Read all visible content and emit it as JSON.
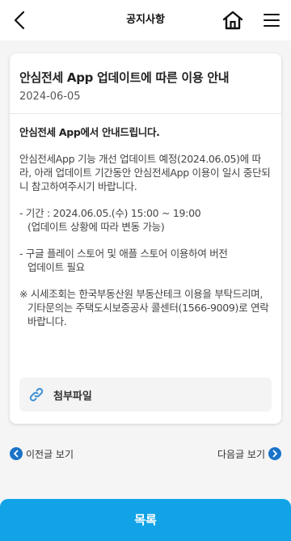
{
  "header": {
    "title": "공지사항"
  },
  "notice": {
    "title": "안심전세 App 업데이트에 따른 이용 안내",
    "date": "2024-06-05",
    "body": {
      "heading": "안심전세 App에서 안내드립니다.",
      "intro": "안심전세App 기능 개선 업데이트 예정(2024.06.05)에 따라, 아래 업데이트 기간동안 안심전세App 이용이 일시 중단되니 참고하여주시기 바랍니다.",
      "period_line1": "- 기간 : 2024.06.05.(수) 15:00 ~ 19:00",
      "period_line2": "(업데이트 상황에 따라 변동 가능)",
      "store_line1": "- 구글 플레이 스토어 및 애플 스토어 이용하여 버전",
      "store_line2": "업데이트 필요",
      "contact": "※ 시세조회는 한국부동산원 부동산테크 이용을 부탁드리며, 기타문의는 주택도시보증공사 콜센터(1566-9009)로 연락 바랍니다."
    }
  },
  "attachment": {
    "label": "첨부파일"
  },
  "nav": {
    "prev_label": "이전글 보기",
    "next_label": "다음글 보기"
  },
  "list_button": {
    "label": "목록"
  },
  "colors": {
    "accent": "#11a3e6",
    "nav_icon": "#1a73c8",
    "link_icon": "#3b8fd6"
  },
  "icons": {
    "back": "chevron-left-icon",
    "home": "home-icon",
    "menu": "hamburger-menu-icon",
    "attachment": "link-icon",
    "prev": "circle-arrow-left-icon",
    "next": "circle-arrow-right-icon"
  }
}
